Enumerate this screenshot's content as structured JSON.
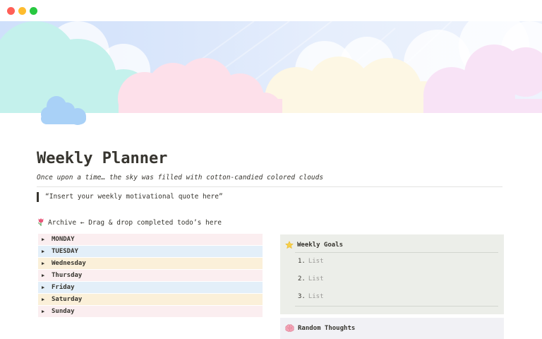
{
  "window": {
    "controls": [
      "close",
      "minimize",
      "maximize"
    ]
  },
  "page": {
    "title": "Weekly Planner",
    "subtitle": "Once upon a time… the sky was filled with cotton-candied colored clouds",
    "quote": "“Insert your weekly motivational quote here”",
    "archive_text": "Archive ← Drag & drop completed todo’s here"
  },
  "days": [
    {
      "label": "MONDAY",
      "color": "#fbeef0"
    },
    {
      "label": "TUESDAY",
      "color": "#e3eff9"
    },
    {
      "label": "Wednesday",
      "color": "#fbf0d9"
    },
    {
      "label": "Thursday",
      "color": "#fbeef0"
    },
    {
      "label": "Friday",
      "color": "#e3eff9"
    },
    {
      "label": "Saturday",
      "color": "#fbf0d9"
    },
    {
      "label": "Sunday",
      "color": "#fbeef0"
    }
  ],
  "weekly_goals": {
    "title": "Weekly Goals",
    "items": [
      {
        "num": "1.",
        "text": "List"
      },
      {
        "num": "2.",
        "text": "List"
      },
      {
        "num": "3.",
        "text": "List"
      }
    ]
  },
  "random_thoughts": {
    "title": "Random Thoughts"
  },
  "icons": {
    "page_icon": "cloud-icon",
    "archive_icon": "tulip-icon",
    "goals_icon": "star-icon",
    "thoughts_icon": "brain-icon",
    "toggle_icon": "triangle-right-icon"
  },
  "colors": {
    "text": "#37352f",
    "muted": "#9b9a97",
    "goals_bg": "#eceee9",
    "thoughts_bg": "#f1f1f5",
    "cloud_mint": "#c4f1ec",
    "cloud_pink": "#fde0ea",
    "cloud_cream": "#fdf7e4",
    "cloud_lavender": "#f8e3f6",
    "cloud_blue": "#a9d1f7"
  }
}
